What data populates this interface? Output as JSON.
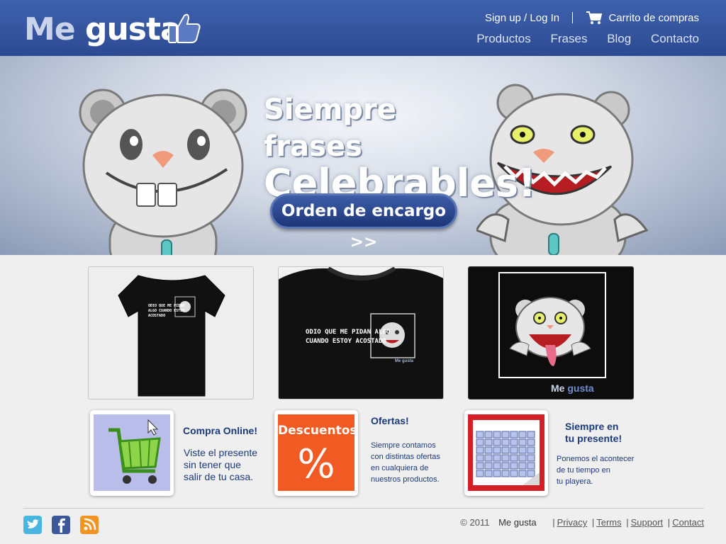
{
  "header": {
    "logo_me": "Me",
    "logo_gusta": "gusta",
    "signup": "Sign up / Log In",
    "cart": "Carrito de compras",
    "nav": [
      "Productos",
      "Frases",
      "Blog",
      "Contacto"
    ]
  },
  "hero": {
    "title_line1": "Siempre frases",
    "title_line2": "Celebrables!",
    "button": "Orden de encargo >>"
  },
  "products": {
    "shirt1_text": "ODIO QUE ME PIDAN ALGO CUANDO ESTOY ACOSTADO",
    "shirt2_line1": "ODIO QUE ME PIDAN ALGO",
    "shirt2_line2": "CUANDO ESTOY ACOSTADO",
    "shirt_brand": "Me gusta",
    "p3_brand_me": "Me",
    "p3_brand_gusta": "gusta"
  },
  "features": [
    {
      "title": "Compra Online!",
      "text": [
        "Viste el presente",
        "sin tener que",
        "salir de tu casa."
      ],
      "icon": "shopping-cart-icon"
    },
    {
      "badge": "Descuentos",
      "percent": "%",
      "title": "Ofertas!",
      "text": [
        "Siempre contamos",
        "con distintas ofertas",
        "en cualquiera de",
        "nuestros productos."
      ],
      "icon": "discount-icon"
    },
    {
      "title_line1": "Siempre en",
      "title_line2": "tu presente!",
      "text": [
        "Ponemos el acontecer",
        "de tu tiempo en",
        "tu playera."
      ],
      "icon": "calendar-icon"
    }
  ],
  "footer": {
    "copyright": "© 2011",
    "brand": "Me gusta",
    "links": [
      "Privacy",
      "Terms",
      "Support",
      "Contact"
    ],
    "social": [
      "twitter-icon",
      "facebook-icon",
      "rss-icon"
    ]
  },
  "colors": {
    "header_blue": "#2f4e96",
    "text_blue": "#1b3a7a",
    "discount_orange": "#f15a22"
  }
}
